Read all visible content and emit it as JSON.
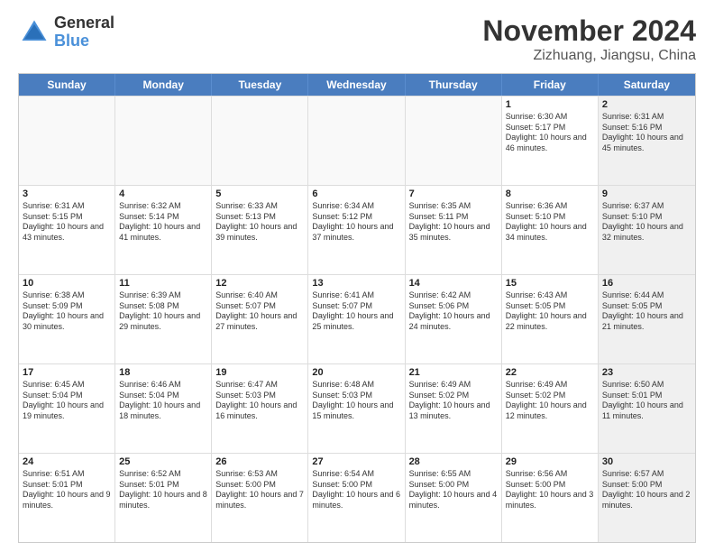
{
  "logo": {
    "general": "General",
    "blue": "Blue"
  },
  "title": "November 2024",
  "subtitle": "Zizhuang, Jiangsu, China",
  "header": {
    "days": [
      "Sunday",
      "Monday",
      "Tuesday",
      "Wednesday",
      "Thursday",
      "Friday",
      "Saturday"
    ]
  },
  "weeks": [
    {
      "cells": [
        {
          "day": "",
          "info": "",
          "shaded": false,
          "empty": true
        },
        {
          "day": "",
          "info": "",
          "shaded": false,
          "empty": true
        },
        {
          "day": "",
          "info": "",
          "shaded": false,
          "empty": true
        },
        {
          "day": "",
          "info": "",
          "shaded": false,
          "empty": true
        },
        {
          "day": "",
          "info": "",
          "shaded": false,
          "empty": true
        },
        {
          "day": "1",
          "info": "Sunrise: 6:30 AM\nSunset: 5:17 PM\nDaylight: 10 hours and 46 minutes.",
          "shaded": false,
          "empty": false
        },
        {
          "day": "2",
          "info": "Sunrise: 6:31 AM\nSunset: 5:16 PM\nDaylight: 10 hours and 45 minutes.",
          "shaded": true,
          "empty": false
        }
      ]
    },
    {
      "cells": [
        {
          "day": "3",
          "info": "Sunrise: 6:31 AM\nSunset: 5:15 PM\nDaylight: 10 hours and 43 minutes.",
          "shaded": false,
          "empty": false
        },
        {
          "day": "4",
          "info": "Sunrise: 6:32 AM\nSunset: 5:14 PM\nDaylight: 10 hours and 41 minutes.",
          "shaded": false,
          "empty": false
        },
        {
          "day": "5",
          "info": "Sunrise: 6:33 AM\nSunset: 5:13 PM\nDaylight: 10 hours and 39 minutes.",
          "shaded": false,
          "empty": false
        },
        {
          "day": "6",
          "info": "Sunrise: 6:34 AM\nSunset: 5:12 PM\nDaylight: 10 hours and 37 minutes.",
          "shaded": false,
          "empty": false
        },
        {
          "day": "7",
          "info": "Sunrise: 6:35 AM\nSunset: 5:11 PM\nDaylight: 10 hours and 35 minutes.",
          "shaded": false,
          "empty": false
        },
        {
          "day": "8",
          "info": "Sunrise: 6:36 AM\nSunset: 5:10 PM\nDaylight: 10 hours and 34 minutes.",
          "shaded": false,
          "empty": false
        },
        {
          "day": "9",
          "info": "Sunrise: 6:37 AM\nSunset: 5:10 PM\nDaylight: 10 hours and 32 minutes.",
          "shaded": true,
          "empty": false
        }
      ]
    },
    {
      "cells": [
        {
          "day": "10",
          "info": "Sunrise: 6:38 AM\nSunset: 5:09 PM\nDaylight: 10 hours and 30 minutes.",
          "shaded": false,
          "empty": false
        },
        {
          "day": "11",
          "info": "Sunrise: 6:39 AM\nSunset: 5:08 PM\nDaylight: 10 hours and 29 minutes.",
          "shaded": false,
          "empty": false
        },
        {
          "day": "12",
          "info": "Sunrise: 6:40 AM\nSunset: 5:07 PM\nDaylight: 10 hours and 27 minutes.",
          "shaded": false,
          "empty": false
        },
        {
          "day": "13",
          "info": "Sunrise: 6:41 AM\nSunset: 5:07 PM\nDaylight: 10 hours and 25 minutes.",
          "shaded": false,
          "empty": false
        },
        {
          "day": "14",
          "info": "Sunrise: 6:42 AM\nSunset: 5:06 PM\nDaylight: 10 hours and 24 minutes.",
          "shaded": false,
          "empty": false
        },
        {
          "day": "15",
          "info": "Sunrise: 6:43 AM\nSunset: 5:05 PM\nDaylight: 10 hours and 22 minutes.",
          "shaded": false,
          "empty": false
        },
        {
          "day": "16",
          "info": "Sunrise: 6:44 AM\nSunset: 5:05 PM\nDaylight: 10 hours and 21 minutes.",
          "shaded": true,
          "empty": false
        }
      ]
    },
    {
      "cells": [
        {
          "day": "17",
          "info": "Sunrise: 6:45 AM\nSunset: 5:04 PM\nDaylight: 10 hours and 19 minutes.",
          "shaded": false,
          "empty": false
        },
        {
          "day": "18",
          "info": "Sunrise: 6:46 AM\nSunset: 5:04 PM\nDaylight: 10 hours and 18 minutes.",
          "shaded": false,
          "empty": false
        },
        {
          "day": "19",
          "info": "Sunrise: 6:47 AM\nSunset: 5:03 PM\nDaylight: 10 hours and 16 minutes.",
          "shaded": false,
          "empty": false
        },
        {
          "day": "20",
          "info": "Sunrise: 6:48 AM\nSunset: 5:03 PM\nDaylight: 10 hours and 15 minutes.",
          "shaded": false,
          "empty": false
        },
        {
          "day": "21",
          "info": "Sunrise: 6:49 AM\nSunset: 5:02 PM\nDaylight: 10 hours and 13 minutes.",
          "shaded": false,
          "empty": false
        },
        {
          "day": "22",
          "info": "Sunrise: 6:49 AM\nSunset: 5:02 PM\nDaylight: 10 hours and 12 minutes.",
          "shaded": false,
          "empty": false
        },
        {
          "day": "23",
          "info": "Sunrise: 6:50 AM\nSunset: 5:01 PM\nDaylight: 10 hours and 11 minutes.",
          "shaded": true,
          "empty": false
        }
      ]
    },
    {
      "cells": [
        {
          "day": "24",
          "info": "Sunrise: 6:51 AM\nSunset: 5:01 PM\nDaylight: 10 hours and 9 minutes.",
          "shaded": false,
          "empty": false
        },
        {
          "day": "25",
          "info": "Sunrise: 6:52 AM\nSunset: 5:01 PM\nDaylight: 10 hours and 8 minutes.",
          "shaded": false,
          "empty": false
        },
        {
          "day": "26",
          "info": "Sunrise: 6:53 AM\nSunset: 5:00 PM\nDaylight: 10 hours and 7 minutes.",
          "shaded": false,
          "empty": false
        },
        {
          "day": "27",
          "info": "Sunrise: 6:54 AM\nSunset: 5:00 PM\nDaylight: 10 hours and 6 minutes.",
          "shaded": false,
          "empty": false
        },
        {
          "day": "28",
          "info": "Sunrise: 6:55 AM\nSunset: 5:00 PM\nDaylight: 10 hours and 4 minutes.",
          "shaded": false,
          "empty": false
        },
        {
          "day": "29",
          "info": "Sunrise: 6:56 AM\nSunset: 5:00 PM\nDaylight: 10 hours and 3 minutes.",
          "shaded": false,
          "empty": false
        },
        {
          "day": "30",
          "info": "Sunrise: 6:57 AM\nSunset: 5:00 PM\nDaylight: 10 hours and 2 minutes.",
          "shaded": true,
          "empty": false
        }
      ]
    }
  ]
}
